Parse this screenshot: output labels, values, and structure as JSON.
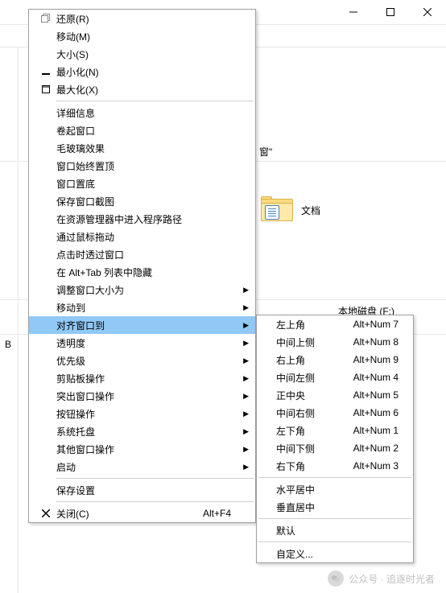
{
  "titlebar": {
    "minimize": "minimize",
    "maximize": "maximize",
    "close": "close"
  },
  "background": {
    "folder_label": "文档",
    "text_frag_1": "窗\"",
    "text_frag_2": "本地磁盘 (F:)",
    "letter": "B"
  },
  "main_menu": [
    {
      "icon": "restore",
      "label": "还原(R)",
      "shortcut": "",
      "submenu": false
    },
    {
      "icon": "",
      "label": "移动(M)",
      "shortcut": "",
      "submenu": false
    },
    {
      "icon": "",
      "label": "大小(S)",
      "shortcut": "",
      "submenu": false
    },
    {
      "icon": "minimize",
      "label": "最小化(N)",
      "shortcut": "",
      "submenu": false
    },
    {
      "icon": "maximize",
      "label": "最大化(X)",
      "shortcut": "",
      "submenu": false
    },
    {
      "sep": true
    },
    {
      "icon": "",
      "label": "详细信息",
      "shortcut": "",
      "submenu": false
    },
    {
      "icon": "",
      "label": "卷起窗口",
      "shortcut": "",
      "submenu": false
    },
    {
      "icon": "",
      "label": "毛玻璃效果",
      "shortcut": "",
      "submenu": false
    },
    {
      "icon": "",
      "label": "窗口始终置顶",
      "shortcut": "",
      "submenu": false
    },
    {
      "icon": "",
      "label": "窗口置底",
      "shortcut": "",
      "submenu": false
    },
    {
      "icon": "",
      "label": "保存窗口截图",
      "shortcut": "",
      "submenu": false
    },
    {
      "icon": "",
      "label": "在资源管理器中进入程序路径",
      "shortcut": "",
      "submenu": false
    },
    {
      "icon": "",
      "label": "通过鼠标拖动",
      "shortcut": "",
      "submenu": false
    },
    {
      "icon": "",
      "label": "点击时透过窗口",
      "shortcut": "",
      "submenu": false
    },
    {
      "icon": "",
      "label": "在 Alt+Tab 列表中隐藏",
      "shortcut": "",
      "submenu": false
    },
    {
      "icon": "",
      "label": "调整窗口大小为",
      "shortcut": "",
      "submenu": true
    },
    {
      "icon": "",
      "label": "移动到",
      "shortcut": "",
      "submenu": true
    },
    {
      "icon": "",
      "label": "对齐窗口到",
      "shortcut": "",
      "submenu": true,
      "hl": true
    },
    {
      "icon": "",
      "label": "透明度",
      "shortcut": "",
      "submenu": true
    },
    {
      "icon": "",
      "label": "优先级",
      "shortcut": "",
      "submenu": true
    },
    {
      "icon": "",
      "label": "剪贴板操作",
      "shortcut": "",
      "submenu": true
    },
    {
      "icon": "",
      "label": "突出窗口操作",
      "shortcut": "",
      "submenu": true
    },
    {
      "icon": "",
      "label": "按钮操作",
      "shortcut": "",
      "submenu": true
    },
    {
      "icon": "",
      "label": "系统托盘",
      "shortcut": "",
      "submenu": true
    },
    {
      "icon": "",
      "label": "其他窗口操作",
      "shortcut": "",
      "submenu": true
    },
    {
      "icon": "",
      "label": "启动",
      "shortcut": "",
      "submenu": true
    },
    {
      "sep": true
    },
    {
      "icon": "",
      "label": "保存设置",
      "shortcut": "",
      "submenu": false
    },
    {
      "sep": true
    },
    {
      "icon": "close",
      "label": "关闭(C)",
      "shortcut": "Alt+F4",
      "submenu": false
    }
  ],
  "sub_menu": [
    {
      "label": "左上角",
      "shortcut": "Alt+Num 7"
    },
    {
      "label": "中间上侧",
      "shortcut": "Alt+Num 8"
    },
    {
      "label": "右上角",
      "shortcut": "Alt+Num 9"
    },
    {
      "label": "中间左侧",
      "shortcut": "Alt+Num 4"
    },
    {
      "label": "正中央",
      "shortcut": "Alt+Num 5"
    },
    {
      "label": "中间右侧",
      "shortcut": "Alt+Num 6"
    },
    {
      "label": "左下角",
      "shortcut": "Alt+Num 1"
    },
    {
      "label": "中间下侧",
      "shortcut": "Alt+Num 2"
    },
    {
      "label": "右下角",
      "shortcut": "Alt+Num 3"
    },
    {
      "sep": true
    },
    {
      "label": "水平居中",
      "shortcut": ""
    },
    {
      "label": "垂直居中",
      "shortcut": ""
    },
    {
      "sep": true
    },
    {
      "label": "默认",
      "shortcut": ""
    },
    {
      "sep": true
    },
    {
      "label": "自定义...",
      "shortcut": ""
    }
  ],
  "watermark": "公众号 · 追逐时光者"
}
